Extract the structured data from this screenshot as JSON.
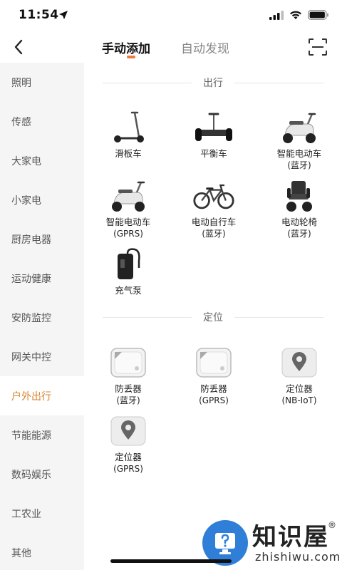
{
  "status_bar": {
    "time": "11:54"
  },
  "nav": {
    "tabs": [
      {
        "label": "手动添加",
        "active": true
      },
      {
        "label": "自动发现",
        "active": false
      }
    ]
  },
  "sidebar": {
    "items": [
      {
        "label": "照明"
      },
      {
        "label": "传感"
      },
      {
        "label": "大家电"
      },
      {
        "label": "小家电"
      },
      {
        "label": "厨房电器"
      },
      {
        "label": "运动健康"
      },
      {
        "label": "安防监控"
      },
      {
        "label": "网关中控"
      },
      {
        "label": "户外出行",
        "active": true
      },
      {
        "label": "节能能源"
      },
      {
        "label": "数码娱乐"
      },
      {
        "label": "工农业"
      },
      {
        "label": "其他"
      }
    ]
  },
  "sections": {
    "travel": {
      "title": "出行",
      "devices": [
        {
          "name": "滑板车",
          "sub": "",
          "icon": "scooter-icon"
        },
        {
          "name": "平衡车",
          "sub": "",
          "icon": "balance-board-icon"
        },
        {
          "name": "智能电动车",
          "sub": "(蓝牙)",
          "icon": "e-moped-icon"
        },
        {
          "name": "智能电动车",
          "sub": "(GPRS)",
          "icon": "e-moped-icon"
        },
        {
          "name": "电动自行车",
          "sub": "(蓝牙)",
          "icon": "e-bike-icon"
        },
        {
          "name": "电动轮椅",
          "sub": "(蓝牙)",
          "icon": "wheelchair-icon"
        },
        {
          "name": "充气泵",
          "sub": "",
          "icon": "air-pump-icon"
        }
      ]
    },
    "location": {
      "title": "定位",
      "devices": [
        {
          "name": "防丢器",
          "sub": "(蓝牙)",
          "icon": "tag-tracker-icon"
        },
        {
          "name": "防丢器",
          "sub": "(GPRS)",
          "icon": "tag-tracker-icon"
        },
        {
          "name": "定位器",
          "sub": "(NB-IoT)",
          "icon": "locator-pin-icon"
        },
        {
          "name": "定位器",
          "sub": "(GPRS)",
          "icon": "locator-pin-icon"
        }
      ]
    }
  },
  "watermark": {
    "text": "知识屋",
    "sub": "zhishiwu.com",
    "reg": "®"
  },
  "colors": {
    "accent": "#f07a3a",
    "active_sidebar": "#d9822b",
    "sidebar_bg": "#f5f5f5"
  }
}
